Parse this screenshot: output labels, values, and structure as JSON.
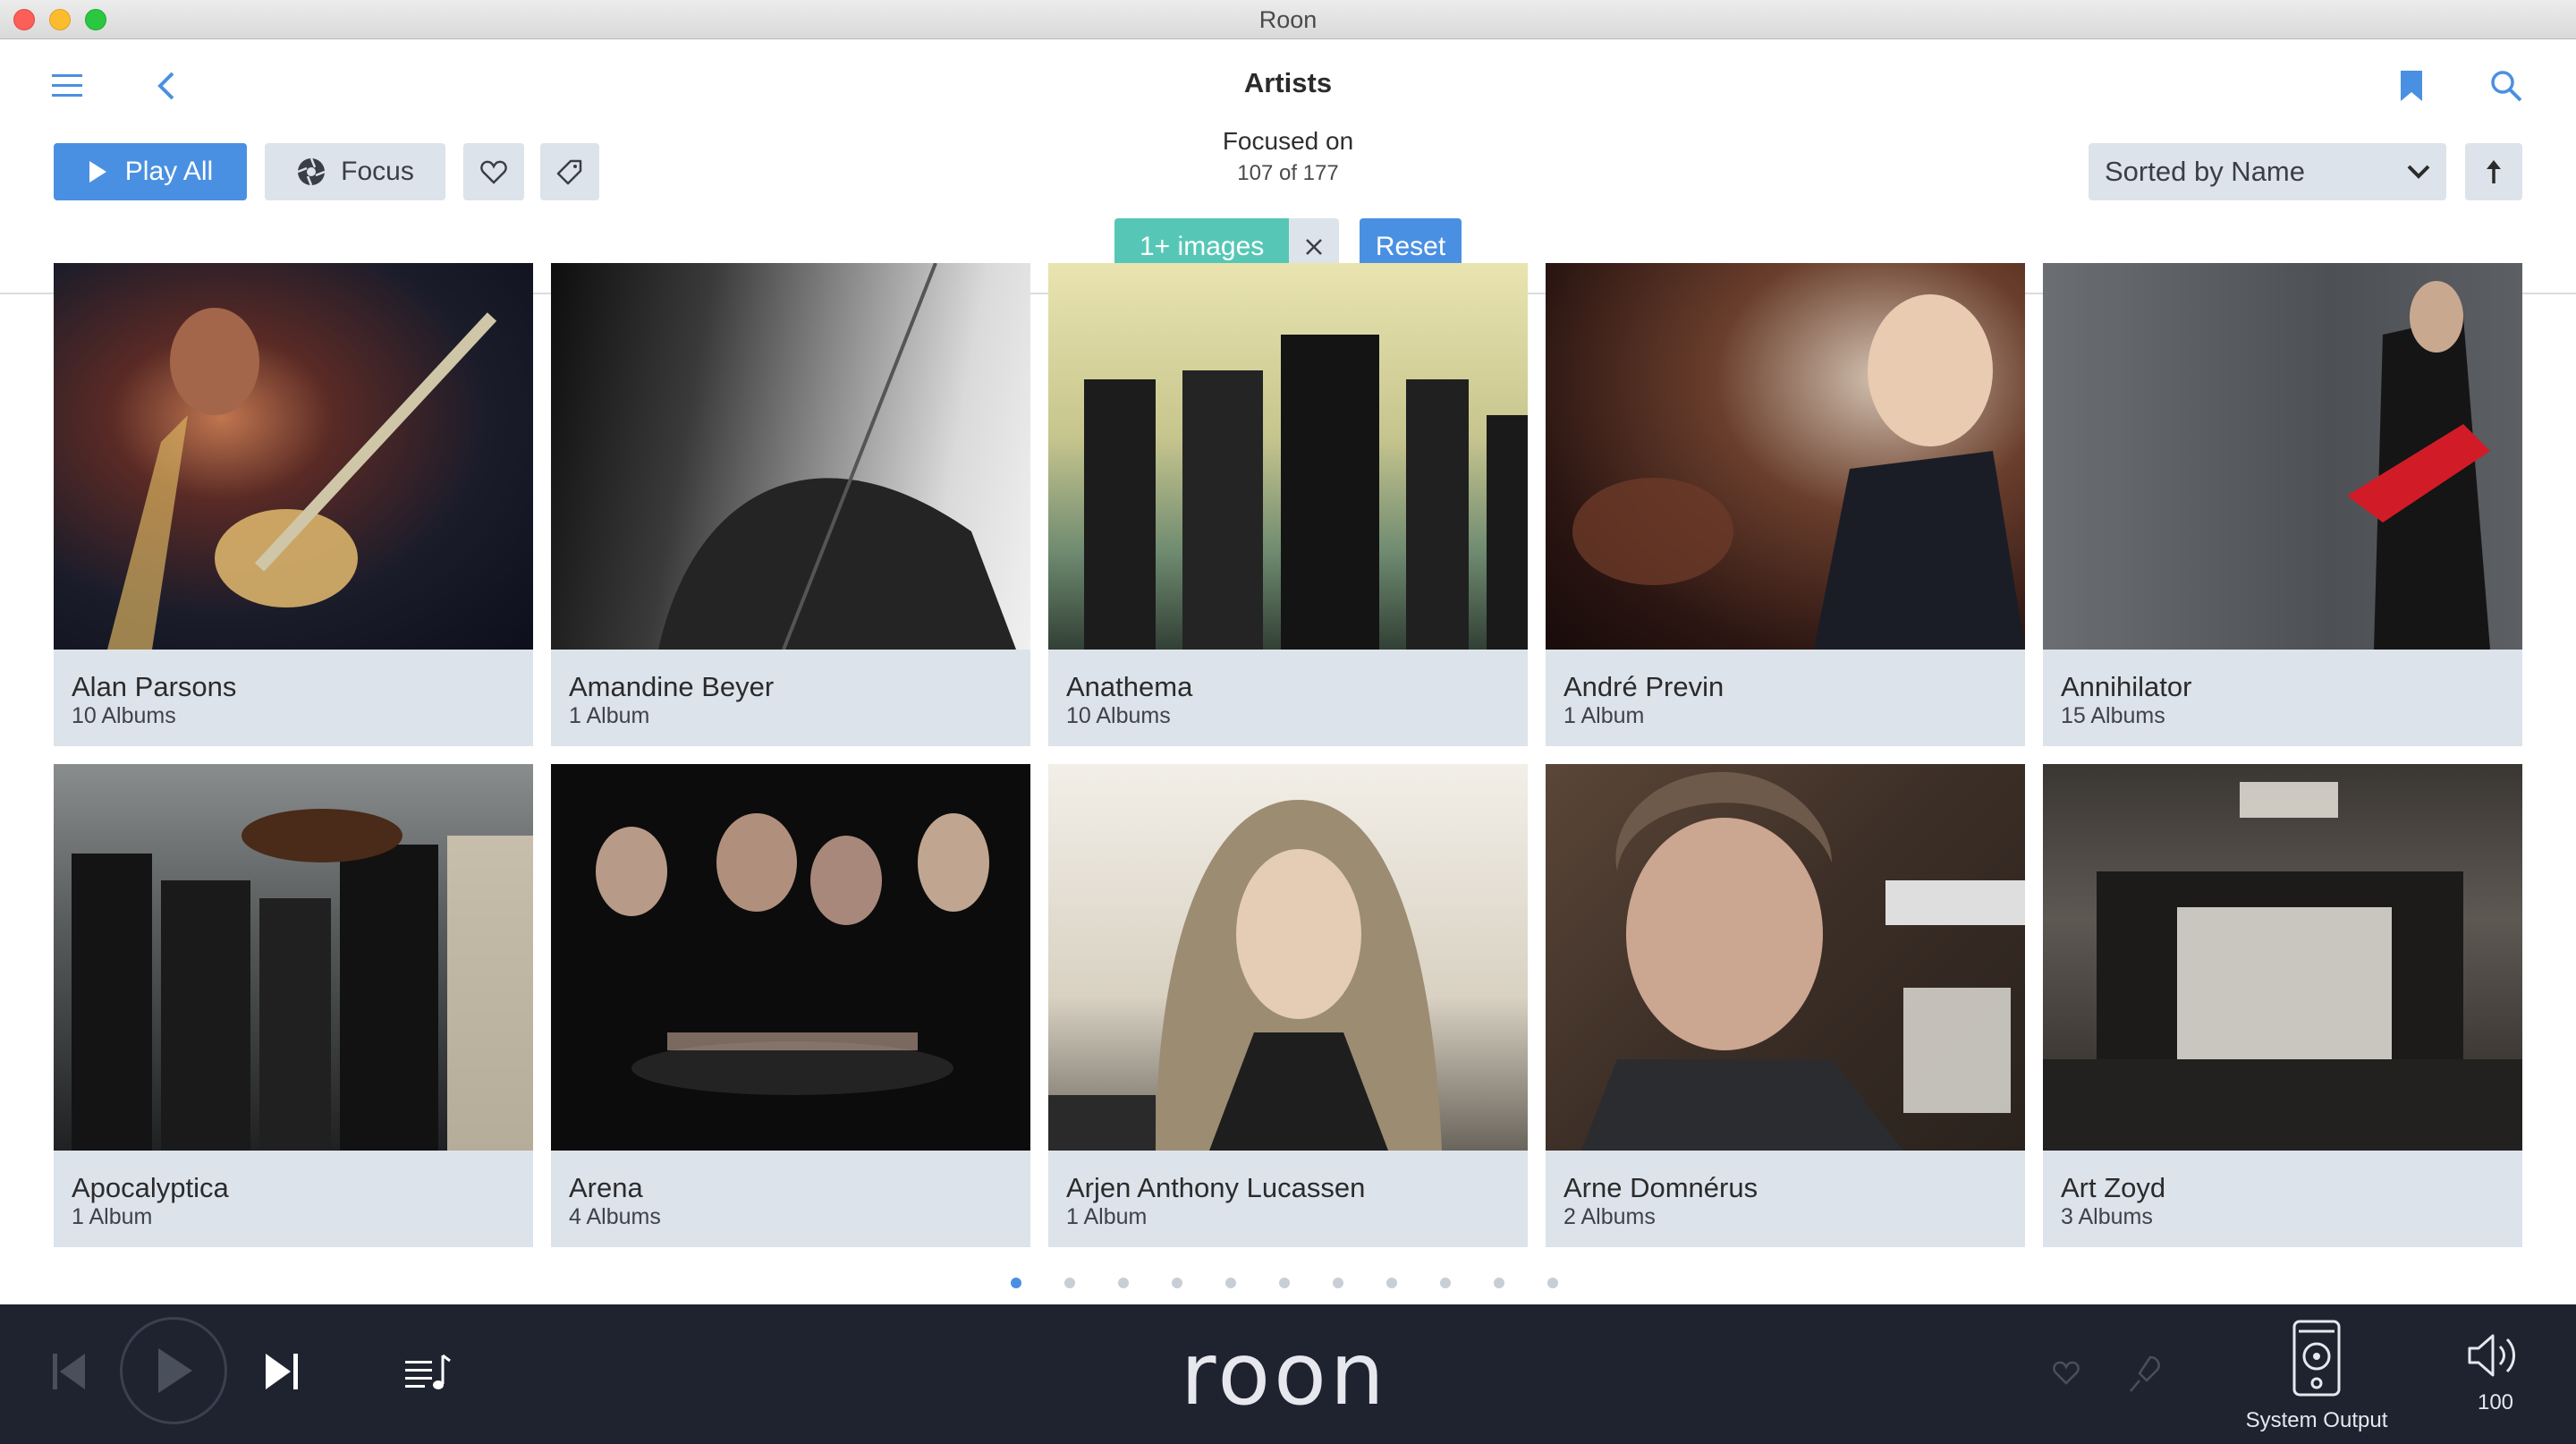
{
  "window": {
    "title": "Roon"
  },
  "header": {
    "title": "Artists",
    "icons": {
      "menu": "hamburger-menu-icon",
      "back": "chevron-left-icon",
      "bookmark": "bookmark-icon",
      "search": "search-icon"
    }
  },
  "toolbar": {
    "play_all_label": "Play All",
    "focus_label": "Focus",
    "focused_on_label": "Focused on",
    "focused_count": "107 of 177",
    "filter_chip_label": "1+ images",
    "reset_label": "Reset",
    "sort_label": "Sorted by Name"
  },
  "artists": [
    {
      "name": "Alan Parsons",
      "albums": "10 Albums"
    },
    {
      "name": "Amandine Beyer",
      "albums": "1 Album"
    },
    {
      "name": "Anathema",
      "albums": "10 Albums"
    },
    {
      "name": "André Previn",
      "albums": "1 Album"
    },
    {
      "name": "Annihilator",
      "albums": "15 Albums"
    },
    {
      "name": "Apocalyptica",
      "albums": "1 Album"
    },
    {
      "name": "Arena",
      "albums": "4 Albums"
    },
    {
      "name": "Arjen Anthony Lucassen",
      "albums": "1 Album"
    },
    {
      "name": "Arne Domnérus",
      "albums": "2 Albums"
    },
    {
      "name": "Art Zoyd",
      "albums": "3 Albums"
    }
  ],
  "pagination": {
    "page_count": 11,
    "current_page": 1
  },
  "player": {
    "logo_text": "roon",
    "output_label": "System Output",
    "volume": "100"
  },
  "colors": {
    "accent": "#4a90e2",
    "chip": "#56c7b6",
    "card_bg": "#dde3eb",
    "player_bg": "#1f2330"
  }
}
